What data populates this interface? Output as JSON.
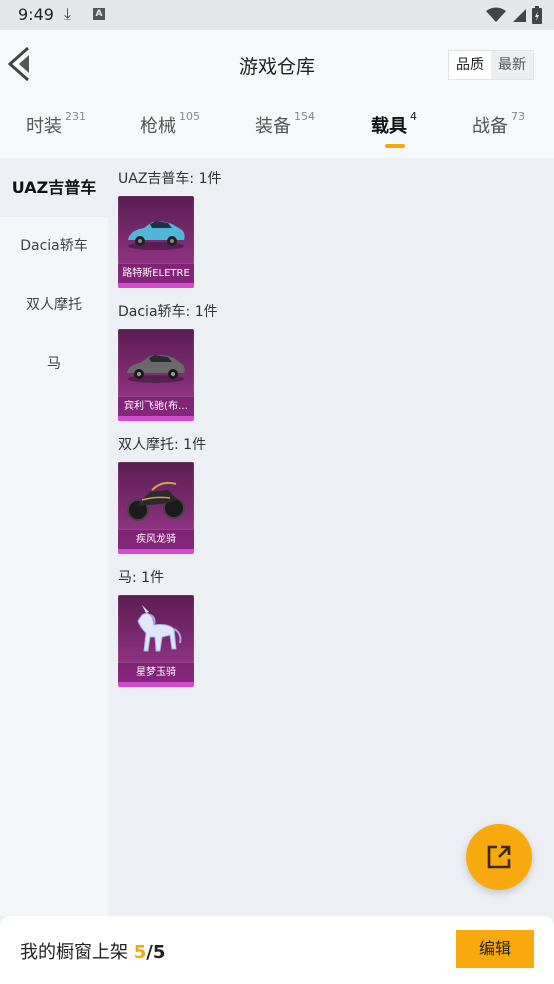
{
  "status": {
    "time": "9:49",
    "a_icon": "A"
  },
  "header": {
    "title": "游戏仓库",
    "sort": {
      "quality": "品质",
      "latest": "最新"
    }
  },
  "tabs": [
    {
      "label": "时装",
      "count": "231"
    },
    {
      "label": "枪械",
      "count": "105"
    },
    {
      "label": "装备",
      "count": "154"
    },
    {
      "label": "载具",
      "count": "4"
    },
    {
      "label": "战备",
      "count": "73"
    }
  ],
  "sidebar": {
    "items": [
      {
        "label": "UAZ吉普车"
      },
      {
        "label": "Dacia轿车"
      },
      {
        "label": "双人摩托"
      },
      {
        "label": "马"
      }
    ]
  },
  "groups": [
    {
      "title": "UAZ吉普车: 1件",
      "item": {
        "name": "路特斯ELETRE",
        "icon": "car-icon"
      }
    },
    {
      "title": "Dacia轿车: 1件",
      "item": {
        "name": "宾利飞驰(布…",
        "icon": "sedan-icon"
      }
    },
    {
      "title": "双人摩托: 1件",
      "item": {
        "name": "疾风龙骑",
        "icon": "motorcycle-icon"
      }
    },
    {
      "title": "马: 1件",
      "item": {
        "name": "星梦玉骑",
        "icon": "unicorn-icon"
      }
    }
  ],
  "bottom": {
    "label": "我的橱窗上架",
    "current": "5",
    "separator": "/",
    "total": "5",
    "edit_label": "编辑"
  },
  "colors": {
    "accent": "#f7a90e",
    "card": "#8c3180"
  }
}
